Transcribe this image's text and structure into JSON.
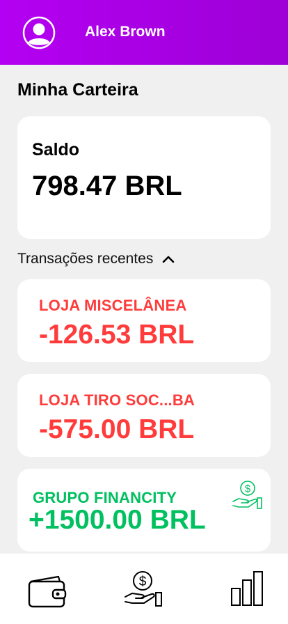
{
  "header": {
    "user_name": "Alex Brown",
    "avatar_icon": "user-avatar-icon",
    "background": "#b400f2"
  },
  "page": {
    "title": "Minha Carteira"
  },
  "balance": {
    "label": "Saldo",
    "value": "798.47 BRL"
  },
  "transactions_section": {
    "label": "Transações recentes",
    "toggle_icon": "chevron-up-icon"
  },
  "transactions": [
    {
      "name": "LOJA MISCELÂNEA",
      "amount": "-126.53 BRL",
      "color": "#ff3b3b"
    },
    {
      "name": "LOJA TIRO SOC...BA",
      "amount": "-575.00 BRL",
      "color": "#ff3b3b"
    },
    {
      "name": "GRUPO FINANCITY",
      "amount": "+1500.00 BRL",
      "color": "#00c060",
      "icon": "money-hand-icon"
    }
  ],
  "bottom_nav": {
    "items": [
      {
        "icon": "wallet-icon"
      },
      {
        "icon": "money-hand-icon"
      },
      {
        "icon": "bar-chart-icon"
      }
    ]
  },
  "colors": {
    "negative": "#ff3b3b",
    "positive": "#00c060",
    "brand": "#b400f2"
  }
}
